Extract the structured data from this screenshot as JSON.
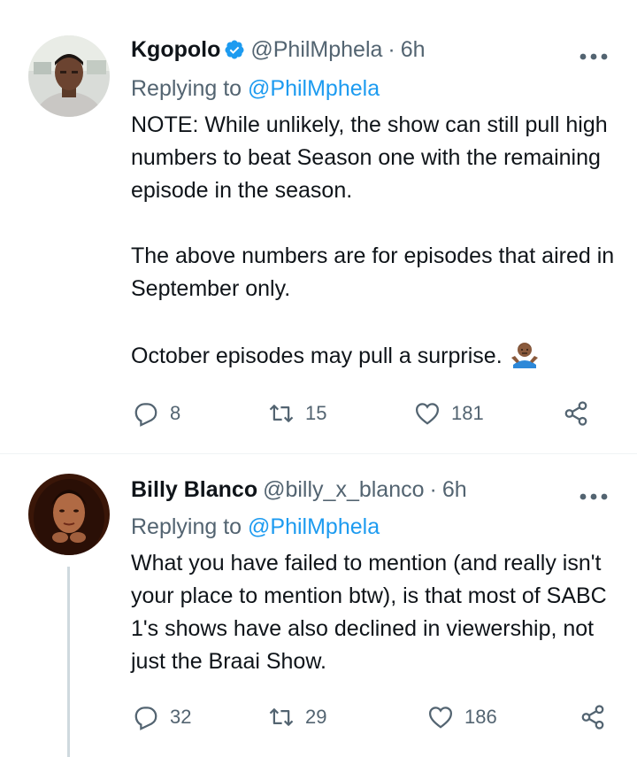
{
  "tweets": [
    {
      "display_name": "Kgopolo",
      "verified": true,
      "handle": "@PhilMphela",
      "sep": "·",
      "time": "6h",
      "replying_label": "Replying to",
      "replying_handle": "@PhilMphela",
      "paragraphs": [
        "NOTE: While unlikely, the show can still pull high numbers to beat Season one with the remaining episode in the season.",
        "The above numbers are for episodes that aired in September only.",
        "October episodes may pull a surprise."
      ],
      "emoji": "person-shrugging-icon",
      "replies": "8",
      "retweets": "15",
      "likes": "181"
    },
    {
      "display_name": "Billy Blanco",
      "verified": false,
      "handle": "@billy_x_blanco",
      "sep": "·",
      "time": "6h",
      "replying_label": "Replying to",
      "replying_handle": "@PhilMphela",
      "paragraphs": [
        "What you have failed to mention (and really isn't your place to mention btw), is that most of SABC 1's shows have also declined in viewership, not just the Braai Show."
      ],
      "replies": "32",
      "retweets": "29",
      "likes": "186"
    }
  ],
  "colors": {
    "text": "#0f1419",
    "secondary": "#536471",
    "accent": "#1d9bf0",
    "divider": "#eff3f4"
  }
}
